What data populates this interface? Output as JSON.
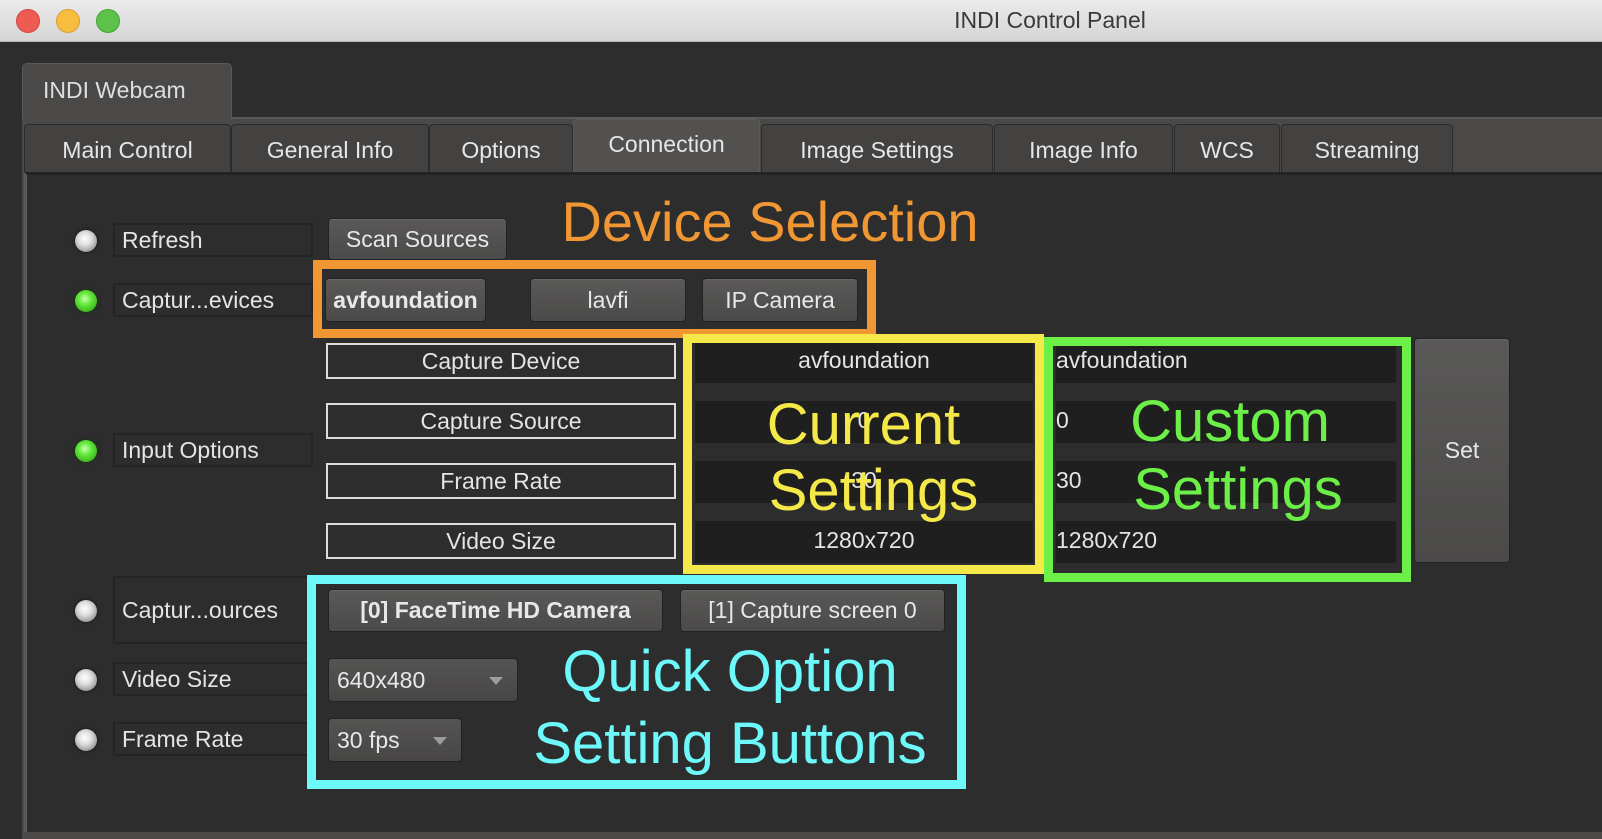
{
  "window": {
    "title": "INDI Control Panel",
    "controls": [
      "close",
      "minimize",
      "maximize"
    ]
  },
  "device_tab": {
    "label": "INDI Webcam",
    "mnemonic_index": 5
  },
  "tabs": [
    {
      "label": "Main Control",
      "active": false
    },
    {
      "label": "General Info",
      "active": false
    },
    {
      "label": "Options",
      "active": false
    },
    {
      "label": "Connection",
      "active": true
    },
    {
      "label": "Image Settings",
      "active": false
    },
    {
      "label": "Image Info",
      "active": false
    },
    {
      "label": "WCS",
      "active": false
    },
    {
      "label": "Streaming",
      "active": false
    }
  ],
  "properties": {
    "refresh": {
      "label": "Refresh",
      "state": "idle",
      "button": "Scan Sources"
    },
    "capture_devices": {
      "label": "Captur...evices",
      "state": "ok",
      "options": [
        {
          "label": "avfoundation",
          "selected": true
        },
        {
          "label": "lavfi",
          "selected": false
        },
        {
          "label": "IP Camera",
          "selected": false
        }
      ]
    },
    "input_options": {
      "label": "Input Options",
      "state": "ok",
      "elements": [
        {
          "name": "Capture Device",
          "current": "avfoundation",
          "custom": "avfoundation"
        },
        {
          "name": "Capture Source",
          "current": "0",
          "custom": "0"
        },
        {
          "name": "Frame Rate",
          "current": "30",
          "custom": "30"
        },
        {
          "name": "Video Size",
          "current": "1280x720",
          "custom": "1280x720"
        }
      ],
      "set_button": "Set"
    },
    "capture_sources": {
      "label": "Captur...ources",
      "state": "idle",
      "options": [
        {
          "label": "[0] FaceTime HD Camera",
          "selected": true
        },
        {
          "label": "[1] Capture screen 0",
          "selected": false
        }
      ]
    },
    "video_size": {
      "label": "Video Size",
      "state": "idle",
      "selected": "640x480"
    },
    "frame_rate": {
      "label": "Frame Rate",
      "state": "idle",
      "selected": "30 fps"
    }
  },
  "annotations": {
    "device_selection": {
      "text": "Device Selection",
      "color": "#f09633"
    },
    "current_settings": {
      "line1": "Current",
      "line2": "Settings",
      "color": "#f5e94a"
    },
    "custom_settings": {
      "line1": "Custom",
      "line2": "Settings",
      "color": "#6cf047"
    },
    "quick_options": {
      "line1": "Quick Option",
      "line2": "Setting Buttons",
      "color": "#6df8fa"
    }
  },
  "colors": {
    "led_ok": "#63ea3c",
    "led_idle": "#e0e0e0",
    "background": "#2d2d2d"
  }
}
